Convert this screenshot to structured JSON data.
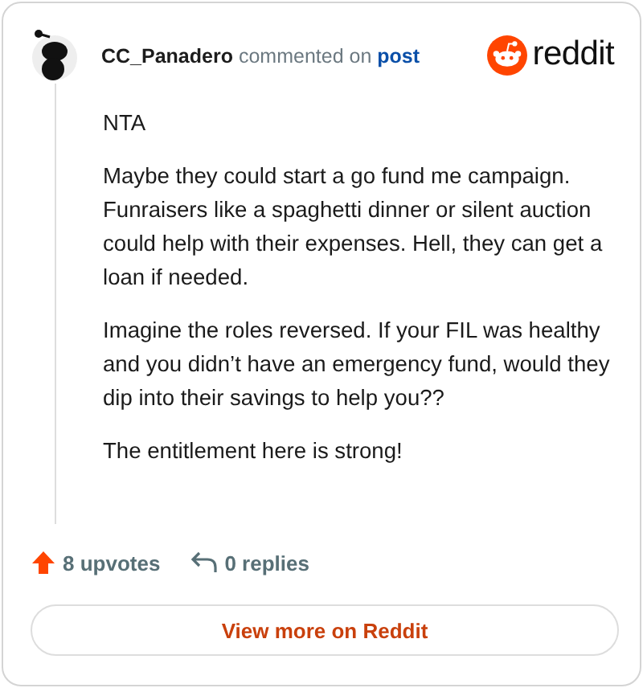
{
  "header": {
    "author": "CC_Panadero",
    "action": "commented on",
    "link": "post",
    "brand": "reddit"
  },
  "paragraphs": [
    "NTA",
    "Maybe they could start a go fund me campaign. Funraisers like a spaghetti dinner or silent auction could help with their expenses. Hell, they can get a loan if needed.",
    "Imagine the roles reversed. If your FIL was healthy and you didn’t have an emergency fund, would they dip into their savings to help you??",
    "The entitlement here is strong!"
  ],
  "footer": {
    "upvotes": "8 upvotes",
    "replies": "0 replies",
    "button": "View more on Reddit"
  }
}
